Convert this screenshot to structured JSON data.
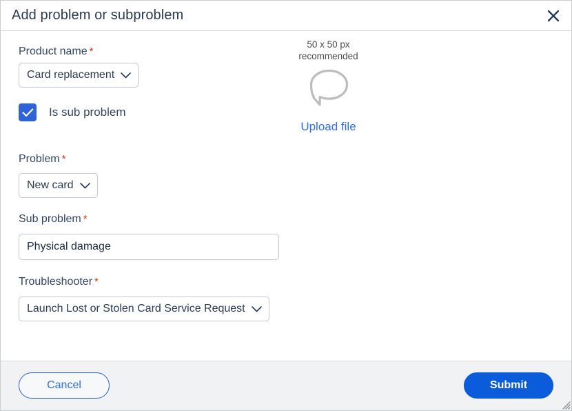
{
  "dialog": {
    "title": "Add problem or subproblem",
    "close_icon": "close-icon"
  },
  "form": {
    "product_name": {
      "label": "Product name",
      "required_mark": "*",
      "value": "Card replacement",
      "caret_icon": "chevron-down-icon"
    },
    "is_sub_problem": {
      "label": "Is sub problem",
      "checked": true,
      "check_icon": "check-icon"
    },
    "problem": {
      "label": "Problem",
      "required_mark": "*",
      "value": "New card",
      "caret_icon": "chevron-down-icon"
    },
    "sub_problem": {
      "label": "Sub problem",
      "required_mark": "*",
      "value": "Physical damage",
      "placeholder": "Sub problem"
    },
    "troubleshooter": {
      "label": "Troubleshooter",
      "required_mark": "*",
      "value": "Launch Lost or Stolen Card Service Request",
      "caret_icon": "chevron-down-icon"
    }
  },
  "upload": {
    "hint": "50 x 50 px\nrecommended",
    "placeholder_icon": "speech-bubble-icon",
    "link_label": "Upload file"
  },
  "footer": {
    "cancel_label": "Cancel",
    "submit_label": "Submit"
  },
  "window": {
    "resize_grip_icon": "resize-grip-icon"
  },
  "colors": {
    "accent_blue": "#0b5cdb",
    "link_blue": "#2f6fe0",
    "checkbox_blue": "#2c63d6",
    "required_red": "#de350b",
    "label_text": "#344563",
    "footer_bg": "#f1f2f4",
    "border": "#c1c7d0",
    "placeholder_gray": "#bdbdbd"
  }
}
